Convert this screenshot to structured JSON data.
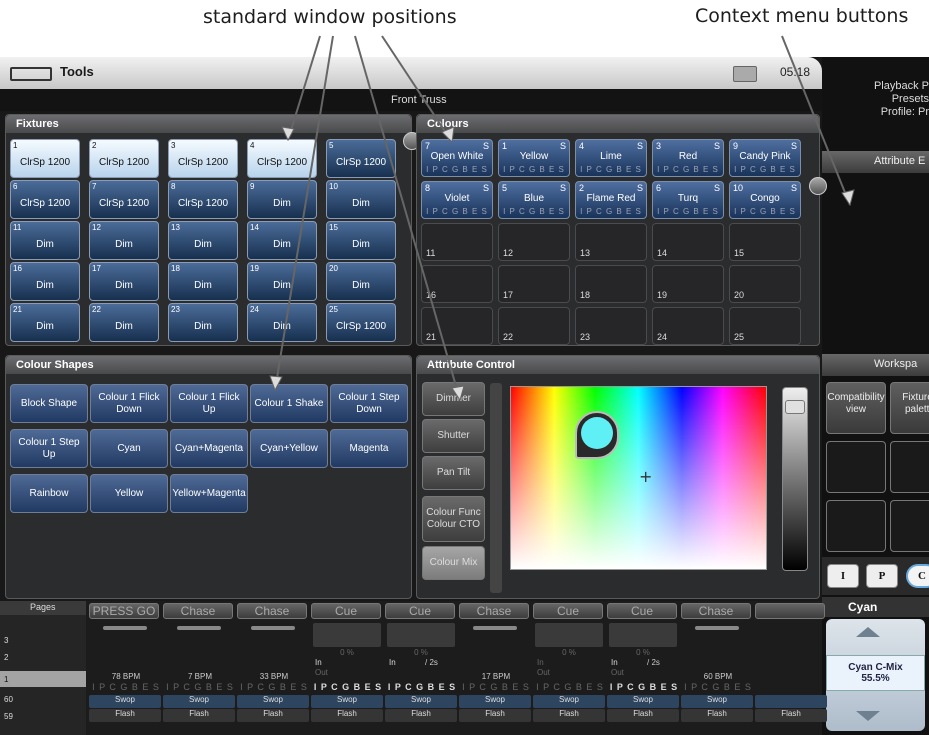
{
  "annotations": {
    "window_positions": "standard window positions",
    "context_menu": "Context menu buttons"
  },
  "toolbar": {
    "tools": "Tools",
    "clock": "05:18"
  },
  "description_bar": "Front Truss",
  "right_panel": {
    "info": [
      "Playback P",
      "Presets",
      "Profile: Pr"
    ],
    "attribute_header": "Attribute E",
    "workspace_header": "Workspa",
    "workspace_buttons": [
      "Compatibility view",
      "Fixtures palette"
    ],
    "mode_buttons": [
      "I",
      "P",
      "C"
    ],
    "palette_name": "Cyan",
    "palette_value": "Cyan C-Mix",
    "palette_percent": "55.5%"
  },
  "fixtures": {
    "title": "Fixtures",
    "items": [
      {
        "num": "1",
        "label": "ClrSp 1200",
        "selected": true
      },
      {
        "num": "2",
        "label": "ClrSp 1200",
        "selected": true
      },
      {
        "num": "3",
        "label": "ClrSp 1200",
        "selected": true
      },
      {
        "num": "4",
        "label": "ClrSp 1200",
        "selected": true
      },
      {
        "num": "5",
        "label": "ClrSp 1200",
        "selected": false
      },
      {
        "num": "6",
        "label": "ClrSp 1200",
        "selected": false
      },
      {
        "num": "7",
        "label": "ClrSp 1200",
        "selected": false
      },
      {
        "num": "8",
        "label": "ClrSp 1200",
        "selected": false
      },
      {
        "num": "9",
        "label": "Dim",
        "selected": false
      },
      {
        "num": "10",
        "label": "Dim",
        "selected": false
      },
      {
        "num": "11",
        "label": "Dim",
        "selected": false
      },
      {
        "num": "12",
        "label": "Dim",
        "selected": false
      },
      {
        "num": "13",
        "label": "Dim",
        "selected": false
      },
      {
        "num": "14",
        "label": "Dim",
        "selected": false
      },
      {
        "num": "15",
        "label": "Dim",
        "selected": false
      },
      {
        "num": "16",
        "label": "Dim",
        "selected": false
      },
      {
        "num": "17",
        "label": "Dim",
        "selected": false
      },
      {
        "num": "18",
        "label": "Dim",
        "selected": false
      },
      {
        "num": "19",
        "label": "Dim",
        "selected": false
      },
      {
        "num": "20",
        "label": "Dim",
        "selected": false
      },
      {
        "num": "21",
        "label": "Dim",
        "selected": false
      },
      {
        "num": "22",
        "label": "Dim",
        "selected": false
      },
      {
        "num": "23",
        "label": "Dim",
        "selected": false
      },
      {
        "num": "24",
        "label": "Dim",
        "selected": false
      },
      {
        "num": "25",
        "label": "ClrSp 1200",
        "selected": false
      }
    ]
  },
  "colours": {
    "title": "Colours",
    "attrs": "I P C G B E S",
    "items": [
      {
        "num": "7",
        "label": "Open White",
        "flag": "S"
      },
      {
        "num": "1",
        "label": "Yellow",
        "flag": "S"
      },
      {
        "num": "4",
        "label": "Lime",
        "flag": "S"
      },
      {
        "num": "3",
        "label": "Red",
        "flag": "S"
      },
      {
        "num": "9",
        "label": "Candy Pink",
        "flag": "S"
      },
      {
        "num": "8",
        "label": "Violet",
        "flag": "S"
      },
      {
        "num": "5",
        "label": "Blue",
        "flag": "S"
      },
      {
        "num": "2",
        "label": "Flame Red",
        "flag": "S"
      },
      {
        "num": "6",
        "label": "Turq",
        "flag": "S"
      },
      {
        "num": "10",
        "label": "Congo",
        "flag": "S"
      },
      {
        "num": "11"
      },
      {
        "num": "12"
      },
      {
        "num": "13"
      },
      {
        "num": "14"
      },
      {
        "num": "15"
      },
      {
        "num": "16"
      },
      {
        "num": "17"
      },
      {
        "num": "18"
      },
      {
        "num": "19"
      },
      {
        "num": "20"
      },
      {
        "num": "21"
      },
      {
        "num": "22"
      },
      {
        "num": "23"
      },
      {
        "num": "24"
      },
      {
        "num": "25"
      }
    ]
  },
  "colour_shapes": {
    "title": "Colour Shapes",
    "items": [
      "Block Shape",
      "Colour 1 Flick Down",
      "Colour 1 Flick Up",
      "Colour 1 Shake",
      "Colour 1 Step Down",
      "Colour 1 Step Up",
      "Cyan",
      "Cyan+Magenta",
      "Cyan+Yellow",
      "Magenta",
      "Rainbow",
      "Yellow",
      "Yellow+Magenta"
    ]
  },
  "attribute_control": {
    "title": "Attribute Control",
    "buttons": [
      "Dimmer",
      "Shutter",
      "Pan Tilt",
      "Colour Func Colour CTO",
      "Colour Mix"
    ],
    "active": "Colour Mix"
  },
  "colours_accent": {
    "selected": "#5ff0f6",
    "fixture_sel": "#cfe4f6",
    "button": "#2f4e7e"
  },
  "playbacks": {
    "pages_label": "Pages",
    "pages": [
      "3",
      "2",
      "1",
      "60",
      "59"
    ],
    "current_page": "1",
    "items": [
      {
        "mode": "PRESS GO",
        "bpm": "78 BPM",
        "attrs": "I P C G B E S",
        "bold": false,
        "swop": "Swop",
        "flash": "Flash"
      },
      {
        "mode": "Chase",
        "bpm": "7 BPM",
        "attrs": "I P C G B E S",
        "bold": false,
        "swop": "Swop",
        "flash": "Flash"
      },
      {
        "mode": "Chase",
        "bpm": "33 BPM",
        "attrs": "I P C G B E S",
        "bold": false,
        "swop": "Swop",
        "flash": "Flash"
      },
      {
        "mode": "Cue",
        "pct": "0 %",
        "fade_in": "In",
        "fade_out": "Out",
        "attrs": "I P C G B E S",
        "bold": true,
        "swop": "Swop",
        "flash": "Flash"
      },
      {
        "mode": "Cue",
        "pct": "0 %",
        "fade_in": "In",
        "fade_time": "/ 2s",
        "attrs": "I P C G B E S",
        "bold": true,
        "swop": "Swop",
        "flash": "Flash"
      },
      {
        "mode": "Chase",
        "bpm": "17 BPM",
        "attrs": "I P C G B E S",
        "bold": false,
        "swop": "Swop",
        "flash": "Flash"
      },
      {
        "mode": "Cue",
        "pct": "0 %",
        "fade_in": "In",
        "fade_out": "Out",
        "attrs": "I P C G B E S",
        "bold": false,
        "swop": "Swop",
        "flash": "Flash"
      },
      {
        "mode": "Cue",
        "pct": "0 %",
        "fade_in": "In",
        "fade_time": "/ 2s",
        "fade_out": "Out",
        "attrs": "I P C G B E S",
        "bold": true,
        "swop": "Swop",
        "flash": "Flash"
      },
      {
        "mode": "Chase",
        "bpm": "60 BPM",
        "attrs": "I P C G B E S",
        "bold": false,
        "swop": "Swop",
        "flash": "Flash"
      },
      {
        "mode": "",
        "swop": "",
        "flash": "Flash"
      }
    ]
  }
}
